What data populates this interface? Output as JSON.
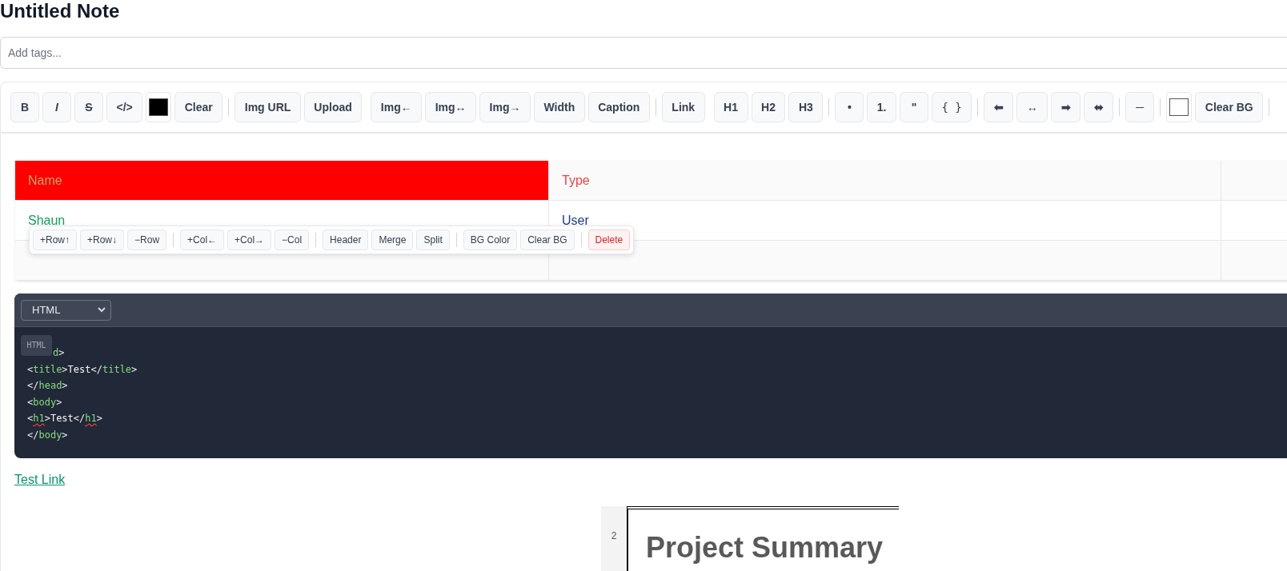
{
  "note_title": "Untitled Note",
  "tags": {
    "placeholder": "Add tags..."
  },
  "toolbar": {
    "sections": [
      {
        "clusters": [
          [
            {
              "kind": "bold",
              "label": "B"
            },
            {
              "kind": "italic",
              "label": "I"
            },
            {
              "kind": "strike",
              "label": "S"
            },
            {
              "kind": "text",
              "label": "</>"
            },
            {
              "kind": "swatch",
              "color": "#000000"
            },
            {
              "kind": "text",
              "label": "Clear"
            }
          ]
        ]
      },
      {
        "clusters": [
          [
            {
              "kind": "text",
              "label": "Img URL"
            },
            {
              "kind": "text",
              "label": "Upload"
            }
          ],
          [
            {
              "kind": "text",
              "label": "Img←"
            },
            {
              "kind": "text",
              "label": "Img↔"
            },
            {
              "kind": "text",
              "label": "Img→"
            },
            {
              "kind": "text",
              "label": "Width"
            },
            {
              "kind": "text",
              "label": "Caption"
            }
          ]
        ]
      },
      {
        "clusters": [
          [
            {
              "kind": "text",
              "label": "Link"
            }
          ],
          [
            {
              "kind": "text",
              "label": "H1"
            },
            {
              "kind": "text",
              "label": "H2"
            },
            {
              "kind": "text",
              "label": "H3"
            }
          ]
        ]
      },
      {
        "clusters": [
          [
            {
              "kind": "text",
              "label": "•"
            },
            {
              "kind": "text",
              "label": "1."
            },
            {
              "kind": "text",
              "label": "\""
            },
            {
              "kind": "mono",
              "label": "{ }"
            }
          ]
        ]
      },
      {
        "clusters": [
          [
            {
              "kind": "text",
              "label": "⬅"
            },
            {
              "kind": "text",
              "label": "↔"
            },
            {
              "kind": "text",
              "label": "➡"
            },
            {
              "kind": "text",
              "label": "⬌"
            }
          ]
        ]
      },
      {
        "clusters": [
          [
            {
              "kind": "text",
              "label": "─"
            }
          ]
        ]
      },
      {
        "clusters": [
          [
            {
              "kind": "swatch",
              "color": "#ffffff"
            },
            {
              "kind": "text",
              "label": "Clear BG"
            }
          ]
        ]
      }
    ]
  },
  "table": {
    "rows": [
      {
        "cells": [
          {
            "text": "Name",
            "color": "#c2a46a",
            "highlight": {
              "color": "#ff0000"
            }
          },
          {
            "text": "Type",
            "color": "#ef4444"
          }
        ]
      },
      {
        "cells": [
          {
            "text": "Shaun",
            "color": "#16a05a"
          },
          {
            "text": "User",
            "color": "#1e3a8a"
          }
        ]
      },
      {
        "cells": []
      }
    ]
  },
  "table_toolbar": {
    "groups": [
      [
        {
          "kind": "normal",
          "label": "+Row↑"
        },
        {
          "kind": "normal",
          "label": "+Row↓"
        },
        {
          "kind": "normal",
          "label": "−Row"
        }
      ],
      [
        {
          "kind": "normal",
          "label": "+Col←"
        },
        {
          "kind": "normal",
          "label": "+Col→"
        },
        {
          "kind": "normal",
          "label": "−Col"
        }
      ],
      [
        {
          "kind": "normal",
          "label": "Header"
        },
        {
          "kind": "normal",
          "label": "Merge"
        },
        {
          "kind": "normal",
          "label": "Split"
        }
      ],
      [
        {
          "kind": "normal",
          "label": "BG Color"
        },
        {
          "kind": "normal",
          "label": "Clear BG"
        }
      ],
      [
        {
          "kind": "danger",
          "label": "Delete"
        }
      ]
    ]
  },
  "code_block": {
    "language": "HTML",
    "badge": "HTML",
    "lines": [
      {
        "partial": true,
        "segments": [
          {
            "kind": "tag",
            "text": "d"
          },
          {
            "kind": "punct",
            "text": ">"
          }
        ]
      },
      {
        "partial": false,
        "segments": [
          {
            "kind": "punct",
            "text": "<"
          },
          {
            "kind": "tag",
            "text": "title"
          },
          {
            "kind": "punct",
            "text": ">"
          },
          {
            "kind": "text",
            "text": "Test"
          },
          {
            "kind": "punct",
            "text": "</"
          },
          {
            "kind": "tag",
            "text": "title"
          },
          {
            "kind": "punct",
            "text": ">"
          }
        ]
      },
      {
        "partial": false,
        "segments": [
          {
            "kind": "punct",
            "text": "</"
          },
          {
            "kind": "tag",
            "text": "head"
          },
          {
            "kind": "punct",
            "text": ">"
          }
        ]
      },
      {
        "partial": false,
        "segments": [
          {
            "kind": "punct",
            "text": "<"
          },
          {
            "kind": "tag",
            "text": "body"
          },
          {
            "kind": "punct",
            "text": ">"
          }
        ]
      },
      {
        "partial": false,
        "segments": [
          {
            "kind": "punct",
            "text": "<"
          },
          {
            "kind": "flagged",
            "text": "h1"
          },
          {
            "kind": "punct",
            "text": ">"
          },
          {
            "kind": "text",
            "text": "Test"
          },
          {
            "kind": "punct",
            "text": "</"
          },
          {
            "kind": "flagged",
            "text": "h1"
          },
          {
            "kind": "punct",
            "text": ">"
          }
        ]
      },
      {
        "partial": false,
        "segments": [
          {
            "kind": "punct",
            "text": "</"
          },
          {
            "kind": "tag",
            "text": "body"
          },
          {
            "kind": "punct",
            "text": ">"
          }
        ]
      }
    ]
  },
  "link": "Test Link",
  "document_preview": {
    "line_number": "2",
    "heading": "Project Summary"
  }
}
